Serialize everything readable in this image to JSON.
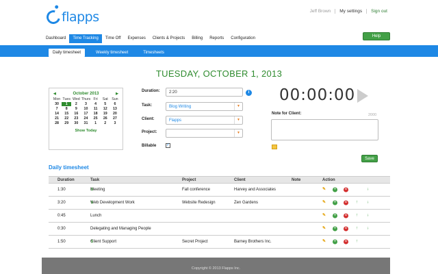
{
  "brand": {
    "name": "flapps"
  },
  "topbar": {
    "user": "Jeff Brown",
    "settings": "My settings",
    "signout": "Sign out"
  },
  "help_label": "Help",
  "nav": {
    "items": [
      {
        "label": "Dashboard"
      },
      {
        "label": "Time Tracking"
      },
      {
        "label": "Time Off"
      },
      {
        "label": "Expenses"
      },
      {
        "label": "Clients & Projects"
      },
      {
        "label": "Billing"
      },
      {
        "label": "Reports"
      },
      {
        "label": "Configuration"
      }
    ],
    "active": "Time Tracking"
  },
  "subnav": {
    "items": [
      {
        "label": "Daily timesheet"
      },
      {
        "label": "Weekly timesheet"
      },
      {
        "label": "Timesheets"
      }
    ]
  },
  "date_title": "TUESDAY, OCTOBER 1, 2013",
  "calendar": {
    "month_label": "October 2013",
    "prev": "◀",
    "next": "▶",
    "days_of_week": [
      "Mon",
      "Tues",
      "Wed",
      "Thurs",
      "Fri",
      "Sat",
      "Sun"
    ],
    "weeks": [
      [
        "30",
        "1",
        "2",
        "3",
        "4",
        "5",
        "6"
      ],
      [
        "7",
        "8",
        "9",
        "10",
        "11",
        "12",
        "13"
      ],
      [
        "14",
        "15",
        "16",
        "17",
        "18",
        "19",
        "20"
      ],
      [
        "21",
        "22",
        "23",
        "24",
        "25",
        "26",
        "27"
      ],
      [
        "28",
        "29",
        "30",
        "31",
        "1",
        "2",
        "3"
      ]
    ],
    "selected": "1",
    "show_today": "Show Today"
  },
  "form": {
    "duration_label": "Duration:",
    "duration_value": "2:20",
    "task_label": "Task:",
    "task_value": "Blog Writing",
    "client_label": "Client:",
    "client_value": "Flapps",
    "project_label": "Project:",
    "project_value": "",
    "billable_label": "Billable",
    "billable_checked": true
  },
  "timer": {
    "display": "00:00:00"
  },
  "note": {
    "label": "Note for Client:",
    "remaining": "2000"
  },
  "save_label": "Save",
  "timesheet": {
    "title": "Daily timesheet",
    "columns": [
      "Duration",
      "Task",
      "Project",
      "Client",
      "Note",
      "Action"
    ],
    "rows": [
      {
        "duration": "1:30",
        "task": "Meeting",
        "billable": true,
        "project": "Fall conference",
        "client": "Harvey and Associates",
        "note": "",
        "up": false,
        "down": true
      },
      {
        "duration": "3:20",
        "task": "Web Development Work",
        "billable": true,
        "project": "Website Redesign",
        "client": "Zen Gardens",
        "note": "",
        "up": true,
        "down": true
      },
      {
        "duration": "0:45",
        "task": "Lunch",
        "billable": false,
        "project": "",
        "client": "",
        "note": "",
        "up": true,
        "down": true
      },
      {
        "duration": "0:30",
        "task": "Delegating and Managing People",
        "billable": false,
        "project": "",
        "client": "",
        "note": "",
        "up": true,
        "down": true
      },
      {
        "duration": "1:50",
        "task": "Client Support",
        "billable": true,
        "project": "Secret Project",
        "client": "Barney Brothers Inc.",
        "note": "",
        "up": true,
        "down": false
      }
    ]
  },
  "footer": {
    "copyright": "Copyright © 2013 Flapps Inc."
  },
  "colors": {
    "brand_blue": "#1e88e5",
    "green": "#2e8b2e",
    "button_green": "#43a047"
  }
}
